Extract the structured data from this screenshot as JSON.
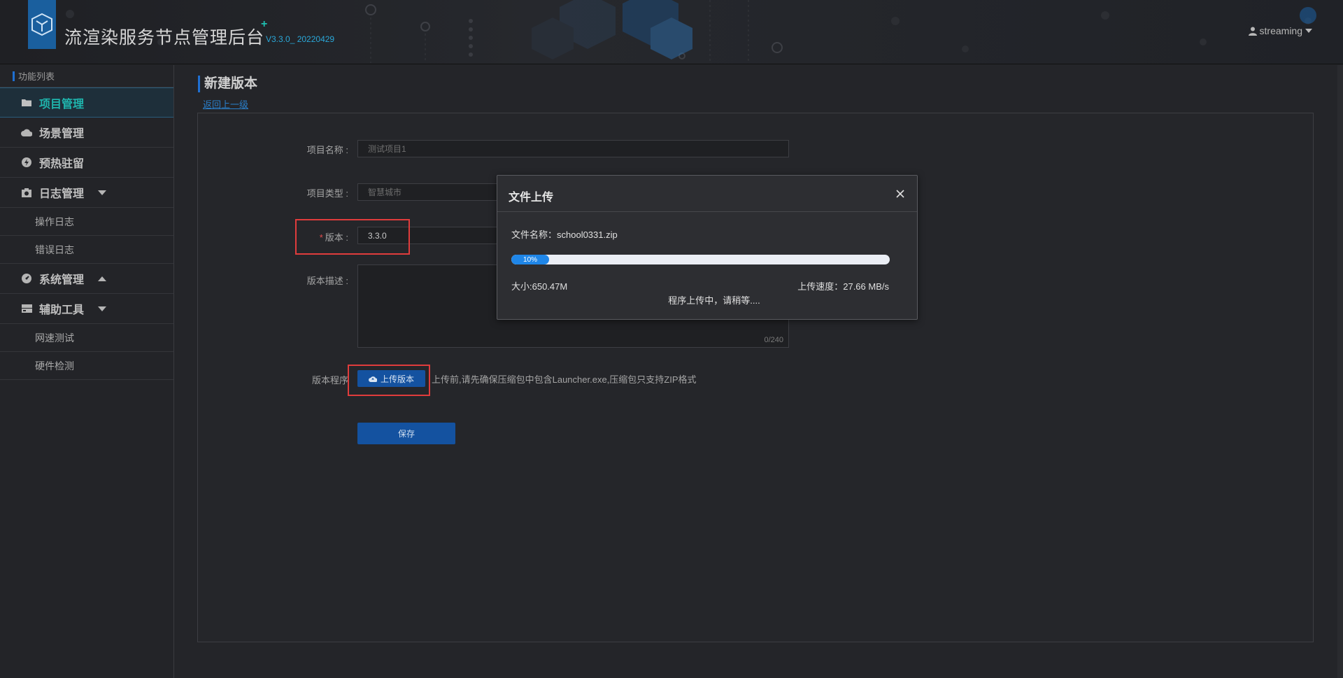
{
  "header": {
    "title": "流渲染服务节点管理后台",
    "version": "V3.3.0_ 20220429",
    "user": "streaming"
  },
  "sidebar": {
    "heading": "功能列表",
    "items": [
      {
        "label": "项目管理",
        "icon": "folder-icon"
      },
      {
        "label": "场景管理",
        "icon": "cloud-icon"
      },
      {
        "label": "预热驻留",
        "icon": "bolt-icon"
      },
      {
        "label": "日志管理",
        "icon": "camera-icon",
        "children": [
          "操作日志",
          "错误日志"
        ]
      },
      {
        "label": "系统管理",
        "icon": "dashboard-icon"
      },
      {
        "label": "辅助工具",
        "icon": "drive-icon",
        "children": [
          "网速测试",
          "硬件检测"
        ]
      }
    ]
  },
  "page": {
    "title": "新建版本",
    "back_link": "返回上一级"
  },
  "form": {
    "project_name_label": "项目名称 :",
    "project_name_value": "测试项目1",
    "project_type_label": "项目类型 :",
    "project_type_value": "智慧城市",
    "version_required": "*",
    "version_label": "版本 :",
    "version_value": "3.3.0",
    "description_label": "版本描述 :",
    "description_count": "0/240",
    "program_label": "版本程序",
    "upload_button": "上传版本",
    "upload_hint": "上传前,请先确保压缩包中包含Launcher.exe,压缩包只支持ZIP格式",
    "save_button": "保存"
  },
  "modal": {
    "title": "文件上传",
    "file_name": "文件名称：school0331.zip",
    "progress_percent": 10,
    "progress_text": "10%",
    "size": "大小:650.47M",
    "speed": "上传速度：27.66 MB/s",
    "status": "程序上传中，请稍等...."
  },
  "colors": {
    "accent": "#1452a0",
    "active_nav": "#1fb5ad",
    "highlight": "#e03c3c",
    "progress": "#1f86e8"
  }
}
